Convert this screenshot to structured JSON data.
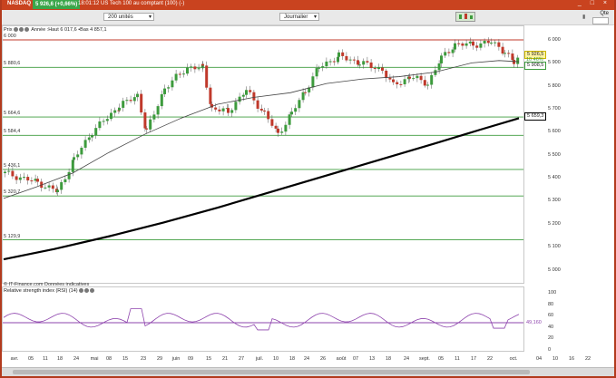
{
  "titlebar": {
    "symbol": "NASDAQ",
    "quote": "5 926,6 (+0,66%)",
    "description": "18:01:12 US Tech 100 au comptant (100) (-)",
    "window_controls": "_ □ ×"
  },
  "toolbar": {
    "units_select": "200 unités",
    "period_select": "Journalier",
    "qte_label": "Qte"
  },
  "price_panel": {
    "label": "Prix",
    "legend": "Année :Haut 6 017,6 •Bas 4 857,1",
    "source": "© IT-Finance.com Données indicatives",
    "current_tags": [
      "5 926,5",
      "10 46%",
      "5 908,5"
    ],
    "level_lines": [
      {
        "value": "6 000",
        "color": "#c0392b"
      },
      {
        "value": "5 880,6",
        "color": "#3d9b3d"
      },
      {
        "value": "5 664,6",
        "color": "#3d9b3d"
      },
      {
        "value": "5 584,4",
        "color": "#3d9b3d"
      },
      {
        "value": "5 436,1",
        "color": "#3d9b3d"
      },
      {
        "value": "5 320,7",
        "color": "#3d9b3d"
      },
      {
        "value": "5 129,9",
        "color": "#3d9b3d"
      }
    ],
    "right_tags": [
      "5 659,3"
    ],
    "y_axis": [
      "6 000",
      "5 900",
      "5 800",
      "5 700",
      "5 600",
      "5 500",
      "5 400",
      "5 300",
      "5 200",
      "5 100",
      "5 000"
    ]
  },
  "rsi_panel": {
    "label": "Relative strength index (RSI) (14)",
    "y_axis": [
      "100",
      "80",
      "60",
      "40",
      "20",
      "0"
    ],
    "current_value": "49,160"
  },
  "x_axis": [
    "avr.",
    "05",
    "11",
    "18",
    "24",
    "mai",
    "08",
    "15",
    "23",
    "29",
    "juin",
    "09",
    "15",
    "21",
    "27",
    "juil.",
    "10",
    "18",
    "24",
    "26",
    "août",
    "07",
    "13",
    "18",
    "24",
    "sept.",
    "05",
    "11",
    "17",
    "22",
    "oct.",
    "04",
    "10",
    "16",
    "22"
  ],
  "colors": {
    "accent": "#c9431f",
    "up_candle": "#3d9b3d",
    "down_candle": "#c0392b",
    "ma_long": "#000000",
    "ma_short": "#444444",
    "rsi_line": "#8e44ad"
  }
}
